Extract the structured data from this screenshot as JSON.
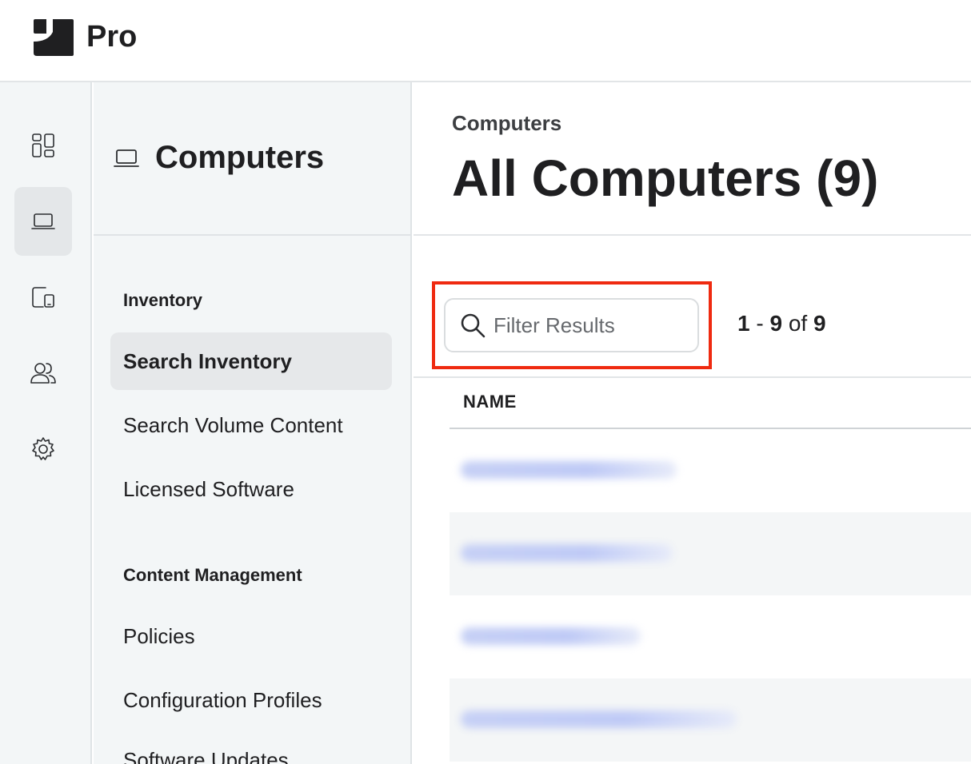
{
  "topbar": {
    "brand": "Pro"
  },
  "rail": {
    "items": [
      {
        "icon": "dashboard-icon",
        "active": false
      },
      {
        "icon": "laptop-icon",
        "active": true
      },
      {
        "icon": "devices-icon",
        "active": false
      },
      {
        "icon": "users-icon",
        "active": false
      },
      {
        "icon": "gear-icon",
        "active": false
      }
    ]
  },
  "subnav": {
    "title": "Computers",
    "icon": "laptop-icon",
    "sections": [
      {
        "label": "Inventory",
        "items": [
          "Search Inventory",
          "Search Volume Content",
          "Licensed Software"
        ]
      },
      {
        "label": "Content Management",
        "items": [
          "Policies",
          "Configuration Profiles",
          "Software Updates"
        ]
      }
    ],
    "active_item": "Search Inventory"
  },
  "main": {
    "breadcrumb": "Computers",
    "title": "All Computers (9)",
    "search": {
      "placeholder": "Filter Results",
      "value": ""
    },
    "pagination": {
      "from": "1",
      "sep": "-",
      "to": "9",
      "of": "of",
      "total": "9"
    },
    "table": {
      "columns": [
        "NAME"
      ],
      "row_count_visible": 4
    }
  },
  "colors": {
    "highlight": "#ef2a10",
    "background_nav": "#f3f6f7",
    "text": "#1f1f21"
  }
}
